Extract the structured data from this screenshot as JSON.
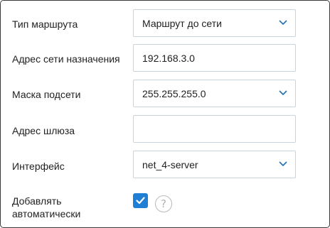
{
  "form": {
    "route_type": {
      "label": "Тип маршрута",
      "value": "Маршрут до сети"
    },
    "destination_network": {
      "label": "Адрес сети назначения",
      "value": "192.168.3.0"
    },
    "subnet_mask": {
      "label": "Маска подсети",
      "value": "255.255.255.0"
    },
    "gateway": {
      "label": "Адрес шлюза",
      "value": ""
    },
    "interface": {
      "label": "Интерфейс",
      "value": "net_4-server"
    },
    "auto_add": {
      "label_line1": "Добавлять",
      "label_line2": "автоматически",
      "checked": true,
      "help_symbol": "?"
    }
  },
  "icons": {
    "dropdown": "chevron-down-icon",
    "checkbox": "checkmark-icon",
    "help": "question-mark-icon"
  },
  "colors": {
    "border": "#c9d3dc",
    "chevron": "#1f6fb5",
    "checkbox": "#1f7fd4",
    "panel_border": "#3a3a3a"
  }
}
